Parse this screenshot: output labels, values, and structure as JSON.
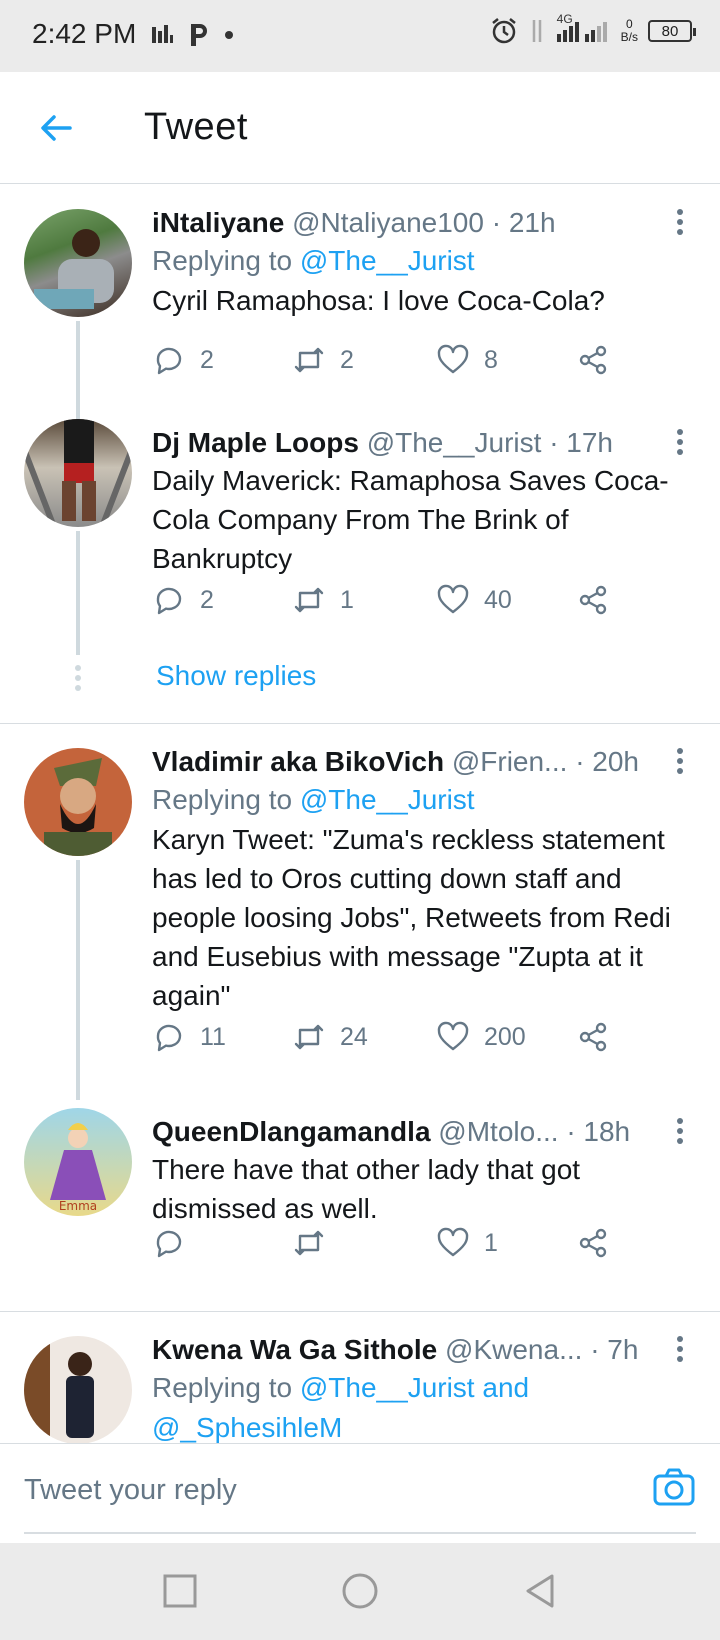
{
  "status_bar": {
    "time": "2:42 PM",
    "network": "4G",
    "netspeed_value": "0",
    "netspeed_unit": "B/s",
    "battery": "80"
  },
  "header": {
    "title": "Tweet"
  },
  "tweets": [
    {
      "name": "iNtaliyane",
      "handle": "@Ntaliyane100",
      "time": "· 21h",
      "replying_prefix": "Replying to ",
      "replying_to": "@The__Jurist",
      "text": "Cyril Ramaphosa: I love Coca-Cola?",
      "replies": "2",
      "retweets": "2",
      "likes": "8"
    },
    {
      "name": "Dj Maple Loops",
      "handle": "@The__Jurist",
      "time": "· 17h",
      "text": "Daily Maverick: Ramaphosa Saves Coca-Cola Company From The Brink of Bankruptcy",
      "replies": "2",
      "retweets": "1",
      "likes": "40",
      "show_replies": "Show replies"
    },
    {
      "name": "Vladimir aka BikoVich",
      "handle": "@Frien...",
      "time": "· 20h",
      "replying_prefix": "Replying to ",
      "replying_to": "@The__Jurist",
      "text": "Karyn Tweet: \"Zuma's reckless statement has led to Oros cutting down staff and people loosing Jobs\", Retweets from Redi and Eusebius with message \"Zupta at it again\"",
      "replies": "11",
      "retweets": "24",
      "likes": "200"
    },
    {
      "name": "QueenDlangamandla",
      "handle": "@Mtolo...",
      "time": "· 18h",
      "text": "There have that other lady that got dismissed as well.",
      "replies": "",
      "retweets": "",
      "likes": "1"
    },
    {
      "name": "Kwena Wa Ga Sithole",
      "handle": "@Kwena...",
      "time": "· 7h",
      "replying_prefix": "Replying to ",
      "replying_to": "@The__Jurist and",
      "replying_to_2": "@_SphesihleM"
    }
  ],
  "composer": {
    "placeholder": "Tweet your reply"
  },
  "colors": {
    "accent": "#1da1f2",
    "secondary_text": "#657786",
    "thread_line": "#cfd9de"
  }
}
